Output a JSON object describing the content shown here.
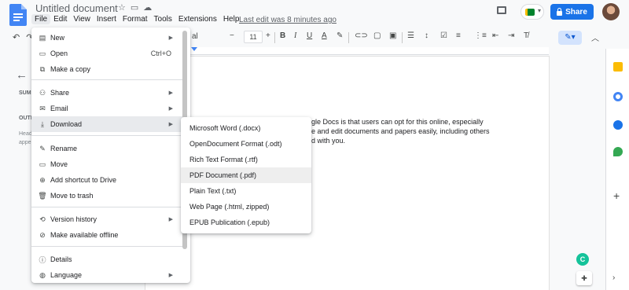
{
  "app": {
    "title": "Untitled document",
    "last_edit": "Last edit was 8 minutes ago",
    "share_label": "Share"
  },
  "menubar": [
    "File",
    "Edit",
    "View",
    "Insert",
    "Format",
    "Tools",
    "Extensions",
    "Help"
  ],
  "toolbar": {
    "font_name": "al",
    "font_size": "11"
  },
  "outline": {
    "summary_label": "SUM",
    "outline_label": "OUTI",
    "hint_line1": "Head",
    "hint_line2": "appe"
  },
  "document": {
    "line1": "gle Docs is that users can opt for this online, especially",
    "line2": "e and edit documents and papers easily, including others",
    "line3": "d with you."
  },
  "file_menu": {
    "items": [
      {
        "label": "New",
        "icon": "new-doc-icon",
        "submenu": true
      },
      {
        "label": "Open",
        "icon": "folder-icon",
        "shortcut": "Ctrl+O"
      },
      {
        "label": "Make a copy",
        "icon": "copy-icon"
      },
      {
        "label": "Share",
        "icon": "share-person-icon",
        "submenu": true
      },
      {
        "label": "Email",
        "icon": "email-icon",
        "submenu": true
      },
      {
        "label": "Download",
        "icon": "download-icon",
        "submenu": true,
        "active": true
      },
      {
        "label": "Rename",
        "icon": "rename-icon"
      },
      {
        "label": "Move",
        "icon": "move-folder-icon"
      },
      {
        "label": "Add shortcut to Drive",
        "icon": "drive-shortcut-icon"
      },
      {
        "label": "Move to trash",
        "icon": "trash-icon"
      },
      {
        "label": "Version history",
        "icon": "history-icon",
        "submenu": true
      },
      {
        "label": "Make available offline",
        "icon": "offline-icon"
      },
      {
        "label": "Details",
        "icon": "info-icon"
      },
      {
        "label": "Language",
        "icon": "globe-icon",
        "submenu": true
      }
    ]
  },
  "download_menu": {
    "items": [
      "Microsoft Word (.docx)",
      "OpenDocument Format (.odt)",
      "Rich Text Format (.rtf)",
      "PDF Document (.pdf)",
      "Plain Text (.txt)",
      "Web Page (.html, zipped)",
      "EPUB Publication (.epub)"
    ],
    "highlighted": "PDF Document (.pdf)"
  },
  "colors": {
    "accent": "#1a73e8",
    "docs_blue": "#4285f4",
    "menu_highlight": "#e8eaed"
  }
}
